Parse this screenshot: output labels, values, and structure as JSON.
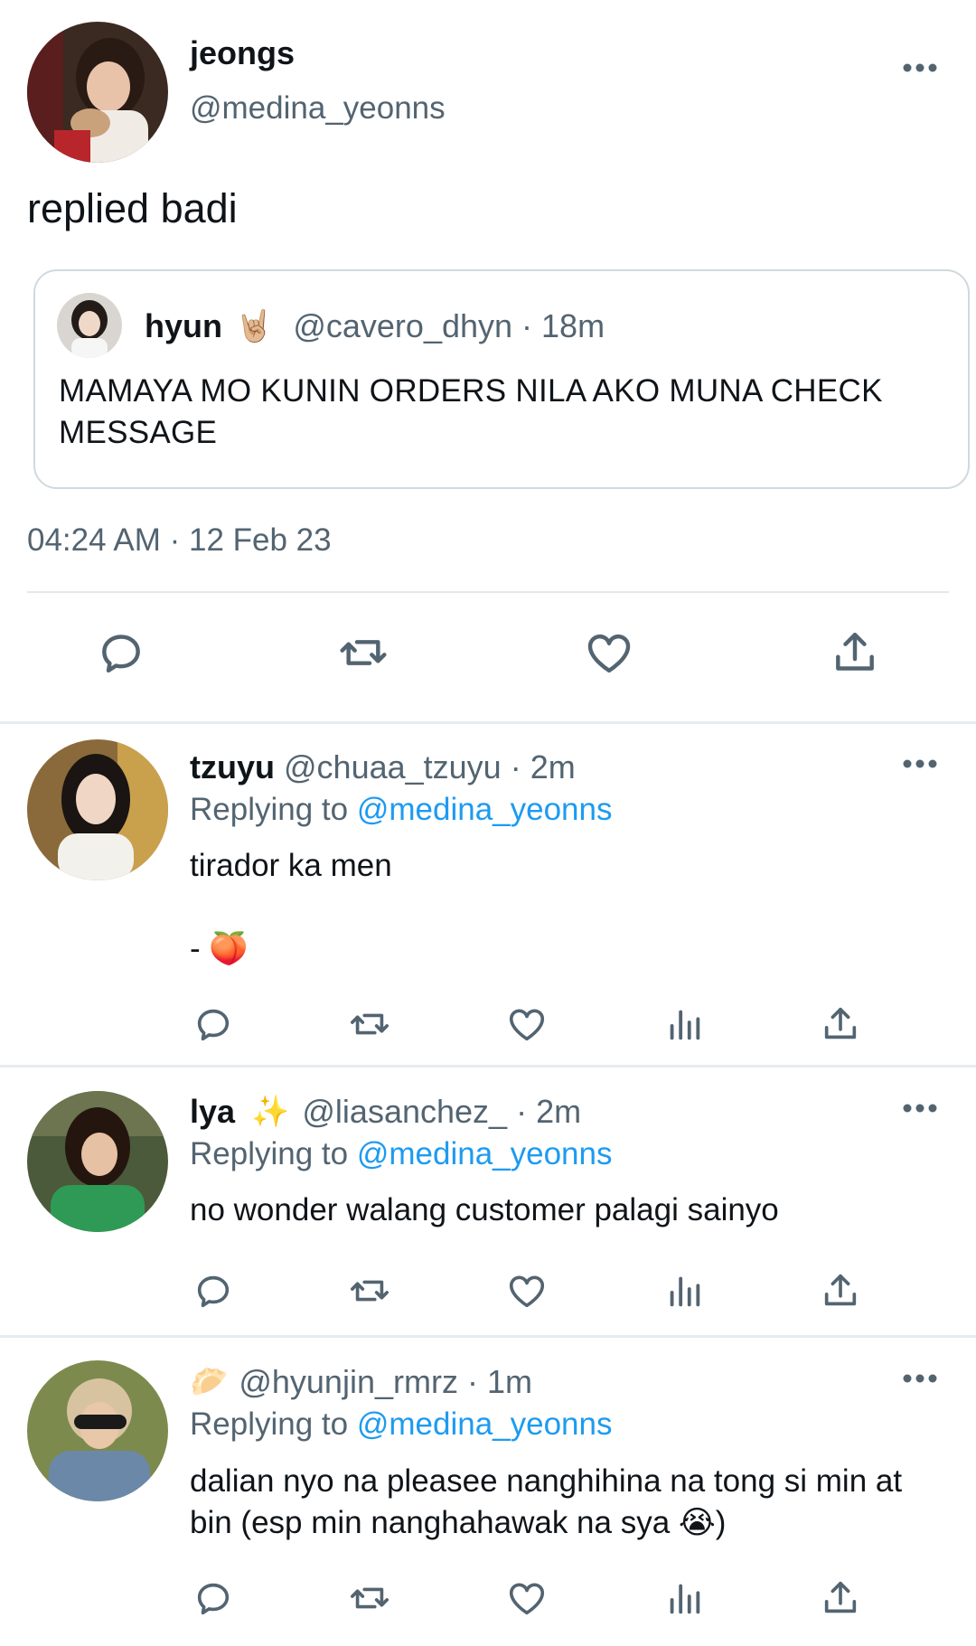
{
  "main_tweet": {
    "author_name": "jeongs",
    "author_handle": "@medina_yeonns",
    "text": "replied badi",
    "quote": {
      "author_name": "hyun",
      "author_emoji": "🤘🏼",
      "author_handle": "@cavero_dhyn",
      "separator": "·",
      "time": "18m",
      "text": "MAMAYA MO KUNIN ORDERS NILA AKO MUNA CHECK MESSAGE"
    },
    "timestamp": "04:24 AM · 12 Feb 23",
    "actions": [
      "reply",
      "retweet",
      "like",
      "share"
    ]
  },
  "replies": [
    {
      "author_name": "tzuyu",
      "author_badge": "",
      "author_handle": "@chuaa_tzuyu",
      "separator": "·",
      "time": "2m",
      "replying_label": "Replying to",
      "replying_to": "@medina_yeonns",
      "text": "tirador ka men\n\n- 🍑"
    },
    {
      "author_name": "lya",
      "author_badge": "✨",
      "author_handle": "@liasanchez_",
      "separator": "·",
      "time": "2m",
      "replying_label": "Replying to",
      "replying_to": "@medina_yeonns",
      "text": "no wonder walang customer palagi sainyo"
    },
    {
      "author_name": "",
      "author_badge": "🥟",
      "author_handle": "@hyunjin_rmrz",
      "separator": "·",
      "time": "1m",
      "replying_label": "Replying to",
      "replying_to": "@medina_yeonns",
      "text": "dalian nyo na pleasee nanghihina na tong si min at bin (esp min nanghahawak na sya 😭)"
    }
  ],
  "icons": {
    "more": "more-horizontal-icon",
    "reply": "reply-bubble-icon",
    "retweet": "retweet-icon",
    "like": "heart-icon",
    "views": "analytics-icon",
    "share": "share-upload-icon"
  },
  "colors": {
    "text_primary": "#0f1419",
    "text_secondary": "#536471",
    "link": "#1d9bf0",
    "icon": "#536471",
    "divider": "#e6ecf0"
  }
}
